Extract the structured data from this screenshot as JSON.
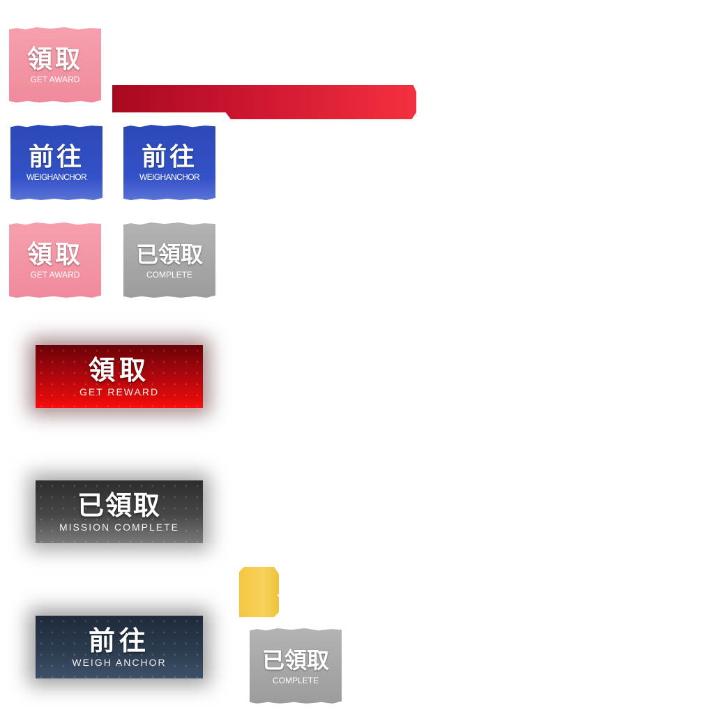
{
  "buttons": {
    "get_award_top": {
      "zh": "領取",
      "en": "GET AWARD"
    },
    "weigh_anchor_1": {
      "zh": "前往",
      "en": "WEIGHANCHOR"
    },
    "weigh_anchor_2": {
      "zh": "前往",
      "en": "WEIGHANCHOR"
    },
    "get_award_mid": {
      "zh": "領取",
      "en": "GET AWARD"
    },
    "complete_small": {
      "zh": "已領取",
      "en": "COMPLETE"
    },
    "get_reward_wide": {
      "zh": "領取",
      "en": "GET REWARD"
    },
    "mission_complete_wide": {
      "zh": "已領取",
      "en": "MISSION COMPLETE"
    },
    "weigh_anchor_wide": {
      "zh": "前往",
      "en": "WEIGH ANCHOR"
    },
    "complete_bottom": {
      "zh": "已領取",
      "en": "COMPLETE"
    }
  },
  "colors": {
    "pink": "#f6a0ad",
    "blue": "#3452c8",
    "gray": "#a8a8a8",
    "banner_red": "#e0202f",
    "reward_red": "#e00a0a",
    "mission_gray": "#474747",
    "navy": "#2c3c50",
    "gold": "#f4c73e"
  }
}
